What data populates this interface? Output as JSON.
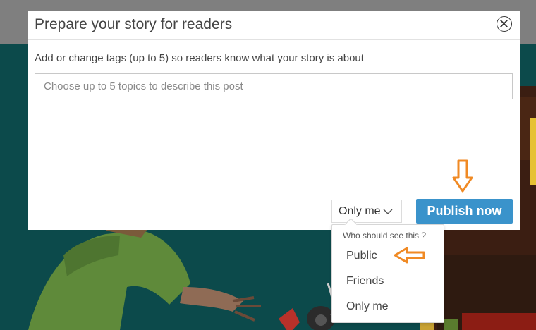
{
  "modal": {
    "title": "Prepare your story for readers",
    "tags_description": "Add or change tags (up to 5) so readers know what your story is about",
    "tags_placeholder": "Choose up to 5 topics to describe this post",
    "tags_value": ""
  },
  "visibility": {
    "selected": "Only me",
    "heading": "Who should see this ?",
    "options": [
      "Public",
      "Friends",
      "Only me"
    ]
  },
  "actions": {
    "publish_label": "Publish now"
  },
  "colors": {
    "publish_button": "#3a93cb",
    "annotation_arrow": "#f08a24",
    "backdrop_teal": "#0c4a4b",
    "top_bar_gray": "#7f7f7f"
  },
  "icons": {
    "close": "close-circle-icon",
    "dropdown": "chevron-down-icon",
    "annotation": "hollow-arrow-icon"
  }
}
